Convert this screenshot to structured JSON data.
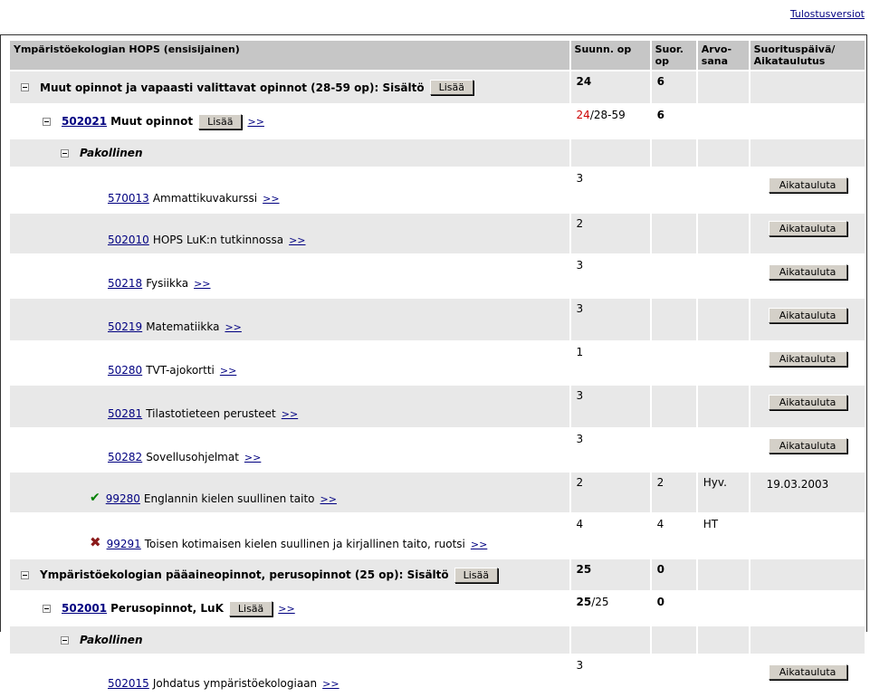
{
  "top_link": "Tulostusversiot",
  "headers": {
    "name": "Ympäristöekologian HOPS (ensisijainen)",
    "planned": "Suunn. op",
    "done": "Suor. op",
    "grade": "Arvo- sana",
    "date": "Suorituspäivä/ Aikataulutus"
  },
  "add_label": "Lisää",
  "schedule_label": "Aikatauluta",
  "more_label": ">>",
  "rows": [
    {
      "kind": "group",
      "indent": 1,
      "text": "Muut opinnot ja vapaasti valittavat opinnot (28-59 op): Sisältö",
      "planned": "24",
      "done": "6",
      "shade": true,
      "height": 37
    },
    {
      "kind": "module",
      "indent": 2,
      "code": "502021",
      "text": "Muut opinnot",
      "planned_red": "24",
      "planned_rest": "/28-59",
      "done": "6",
      "shade": false,
      "height": 38
    },
    {
      "kind": "section",
      "indent": 3,
      "text": "Pakollinen",
      "shade": true,
      "height": 32
    },
    {
      "kind": "course",
      "indent": 4,
      "code": "570013",
      "text": "Ammattikuvakurssi",
      "planned": "3",
      "shade": false,
      "height": 42
    },
    {
      "kind": "course",
      "indent": 4,
      "code": "502010",
      "text": "HOPS LuK:n tutkinnossa",
      "planned": "2",
      "shade": true,
      "height": 38
    },
    {
      "kind": "course",
      "indent": 4,
      "code": "50218",
      "text": "Fysiikka",
      "planned": "3",
      "shade": false,
      "height": 40
    },
    {
      "kind": "course",
      "indent": 4,
      "code": "50219",
      "text": "Matematiikka",
      "planned": "3",
      "shade": true,
      "height": 40
    },
    {
      "kind": "course",
      "indent": 4,
      "code": "50280",
      "text": "TVT-ajokortti",
      "planned": "1",
      "shade": false,
      "height": 40
    },
    {
      "kind": "course",
      "indent": 4,
      "code": "50281",
      "text": "Tilastotieteen perusteet",
      "planned": "3",
      "shade": true,
      "height": 40
    },
    {
      "kind": "course",
      "indent": 4,
      "code": "50282",
      "text": "Sovellusohjelmat",
      "planned": "3",
      "shade": false,
      "height": 40
    },
    {
      "kind": "done",
      "indent": 4,
      "mark": "check",
      "code": "99280",
      "text": "Englannin kielen suullinen taito",
      "planned": "2",
      "done": "2",
      "grade": "Hyv.",
      "date": "19.03.2003",
      "shade": true,
      "height": 38
    },
    {
      "kind": "done",
      "indent": 4,
      "mark": "cross",
      "code": "99291",
      "text": "Toisen kotimaisen kielen suullinen ja kirjallinen taito, ruotsi",
      "planned": "4",
      "done": "4",
      "grade": "HT",
      "date": "",
      "shade": false,
      "height": 42
    },
    {
      "kind": "group",
      "indent": 1,
      "text": "Ympäristöekologian pääaineopinnot, perusopinnot (25 op): Sisältö",
      "planned": "25",
      "done": "0",
      "shade": true,
      "height": 36
    },
    {
      "kind": "module",
      "indent": 2,
      "code": "502001",
      "text": "Perusopinnot, LuK",
      "planned_bold": "25",
      "planned_rest": "/25",
      "done": "0",
      "shade": false,
      "height": 38
    },
    {
      "kind": "section",
      "indent": 3,
      "text": "Pakollinen",
      "shade": true,
      "height": 32
    },
    {
      "kind": "course",
      "indent": 4,
      "code": "502015",
      "text": "Johdatus ympäristöekologiaan",
      "planned": "3",
      "shade": false,
      "height": 40
    }
  ]
}
